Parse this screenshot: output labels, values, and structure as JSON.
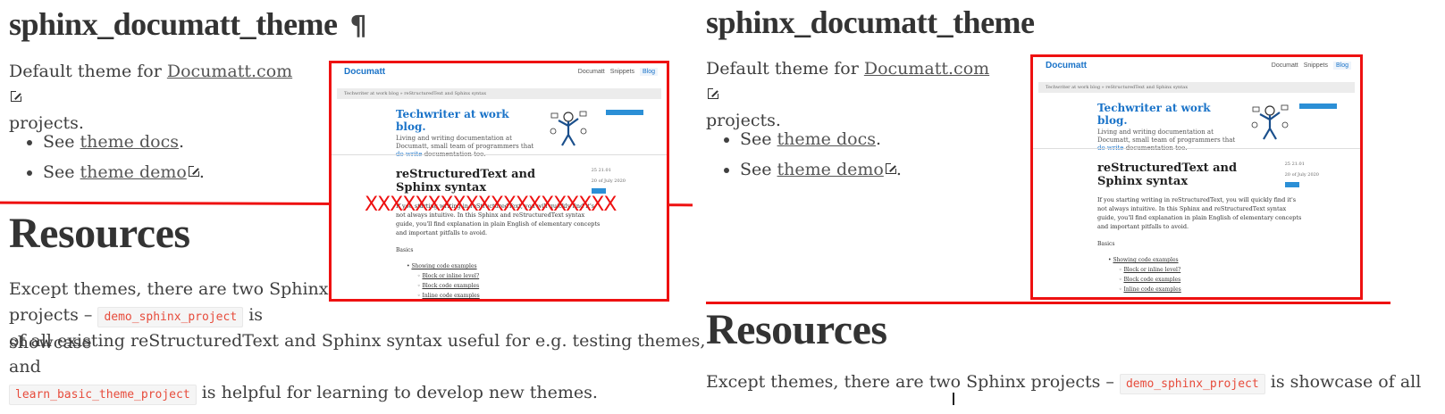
{
  "left": {
    "title": "sphinx_documatt_theme",
    "pilcrow": "¶",
    "intro_before": "Default theme for ",
    "intro_link": "Documatt.com",
    "intro_after": "projects.",
    "bullets": [
      {
        "pre": "See ",
        "link": "theme docs",
        "post": "."
      },
      {
        "pre": "See ",
        "link": "theme demo",
        "post": "."
      }
    ],
    "resources_title": "Resources",
    "res_line1": "Except themes, there are two Sphinx",
    "res_line2a": "projects –",
    "res_code1": "demo_sphinx_project",
    "res_line2b": "is showcase",
    "res_line3": "of all existing reStructuredText and Sphinx syntax useful for e.g. testing themes, and",
    "res_code2": "learn_basic_theme_project",
    "res_line4": "is helpful for learning to develop new themes.",
    "x_marks": "XXXXXXXXXXXXXXXXXXXX"
  },
  "right": {
    "title": "sphinx_documatt_theme",
    "intro_before": "Default theme for ",
    "intro_link": "Documatt.com",
    "intro_after": "projects.",
    "bullets": [
      {
        "pre": "See ",
        "link": "theme docs",
        "post": "."
      },
      {
        "pre": "See ",
        "link": "theme demo",
        "post": "."
      }
    ],
    "resources_title": "Resources",
    "res_line1a": "Except themes, there are two Sphinx projects –",
    "res_code1": "demo_sphinx_project",
    "res_line1b": "is showcase of all"
  },
  "mock": {
    "brand": "Documatt",
    "nav": [
      "Documatt",
      "Snippets",
      "Blog"
    ],
    "crumbs": "Techwriter at work blog   »   reStructuredText and Sphinx syntax",
    "hero_title_a": "Techwriter at work",
    "hero_title_b": " blog.",
    "hero_text": "Living and writing documentation at Documatt, small team of programmers that",
    "hero_link": "do write",
    "hero_text_end": "documentation too.",
    "article_title": "reStructuredText and Sphinx syntax",
    "meta_1": "25 21.01",
    "meta_2": "20 of July 2020",
    "article_text": "If you starting writing in reStructuredText, you will quickly find it's not always intuitive. In this Sphinx and reStructuredText syntax guide, you'll find explanation in plain English of elementary concepts and important pitfalls to avoid.",
    "basics": "Basics",
    "toc_main": "Showing code examples",
    "toc_sub": [
      "Block or inline level?",
      "Block code examples",
      "Inline code examples"
    ]
  },
  "colors": {
    "accent_red": "#ee1111",
    "link_blue": "#1a73c8",
    "code_red": "#e74c3c"
  }
}
